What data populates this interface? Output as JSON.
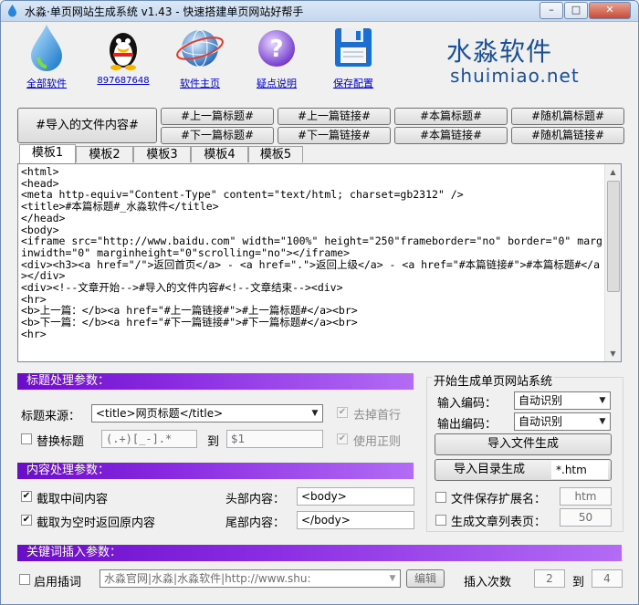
{
  "window": {
    "title": "水淼·单页网站生成系统 v1.43 - 快速搭建单页网站好帮手",
    "minimize": "–",
    "maximize": "□",
    "close": "✕"
  },
  "toolbar": {
    "items": [
      {
        "label": "全部软件",
        "icon": "water-drop-icon"
      },
      {
        "label": "897687648",
        "icon": "qq-penguin-icon"
      },
      {
        "label": "软件主页",
        "icon": "globe-icon"
      },
      {
        "label": "疑点说明",
        "icon": "help-icon"
      },
      {
        "label": "保存配置",
        "icon": "floppy-disk-icon"
      }
    ]
  },
  "brand": {
    "name": "水淼软件",
    "url": "shuimiao.net",
    "color": "#1a4f9a"
  },
  "insert_buttons": {
    "import_content": "#导入的文件内容#",
    "prev_title": "#上一篇标题#",
    "prev_link": "#上一篇链接#",
    "this_title": "#本篇标题#",
    "random_title": "#随机篇标题#",
    "next_title": "#下一篇标题#",
    "next_link": "#下一篇链接#",
    "this_link": "#本篇链接#",
    "random_link": "#随机篇链接#"
  },
  "tabs": [
    "模板1",
    "模板2",
    "模板3",
    "模板4",
    "模板5"
  ],
  "active_tab": "模板1",
  "editor": {
    "content": "<html>\n<head>\n<meta http-equiv=\"Content-Type\" content=\"text/html; charset=gb2312\" />\n<title>#本篇标题#_水淼软件</title>\n</head>\n<body>\n<iframe src=\"http://www.baidu.com\" width=\"100%\" height=\"250\"frameborder=\"no\" border=\"0\" marginwidth=\"0\" marginheight=\"0\"scrolling=\"no\"></iframe>\n<div><h3><a href=\"/\">返回首页</a> - <a href=\".\">返回上级</a> - <a href=\"#本篇链接#\">#本篇标题#</a></div>\n<div><!--文章开始-->#导入的文件内容#<!--文章结束--><div>\n<hr>\n<b>上一篇：</b><a href=\"#上一篇链接#\">#上一篇标题#</a><br>\n<b>下一篇：</b><a href=\"#下一篇链接#\">#下一篇标题#</a><br>\n<hr>"
  },
  "title_params": {
    "header": "标题处理参数：",
    "source_label": "标题来源：",
    "source_value": "<title>网页标题</title>",
    "remove_first_line": "去掉首行",
    "replace_title": "替换标题",
    "replace_from": "(.+)[_-].*",
    "to_label": "到",
    "replace_to": "$1",
    "use_regex": "使用正则"
  },
  "generate": {
    "header": "开始生成单页网站系统",
    "input_encoding_label": "输入编码：",
    "input_encoding": "自动识别",
    "output_encoding_label": "输出编码：",
    "output_encoding": "自动识别",
    "import_file_button": "导入文件生成",
    "import_dir_button": "导入目录生成",
    "dir_pattern": "*.htm",
    "save_ext_label": "文件保存扩展名：",
    "save_ext": "htm",
    "gen_list_label": "生成文章列表页：",
    "list_count": "50"
  },
  "content_params": {
    "header": "内容处理参数：",
    "cut_middle": "截取中间内容",
    "return_full_if_empty": "截取为空时返回原内容",
    "head_label": "头部内容：",
    "head_value": "<body>",
    "tail_label": "尾部内容：",
    "tail_value": "</body>"
  },
  "keyword_params": {
    "header": "关键词插入参数：",
    "enable_label": "启用插词",
    "keywords": "水淼官网|水淼|水淼软件|http://www.shu:",
    "edit_button": "编辑",
    "insert_count_label": "插入次数",
    "count_from": "2",
    "to_label": "到",
    "count_to": "4"
  },
  "colors": {
    "accent": "#8a2be2",
    "link": "#0000cc"
  }
}
